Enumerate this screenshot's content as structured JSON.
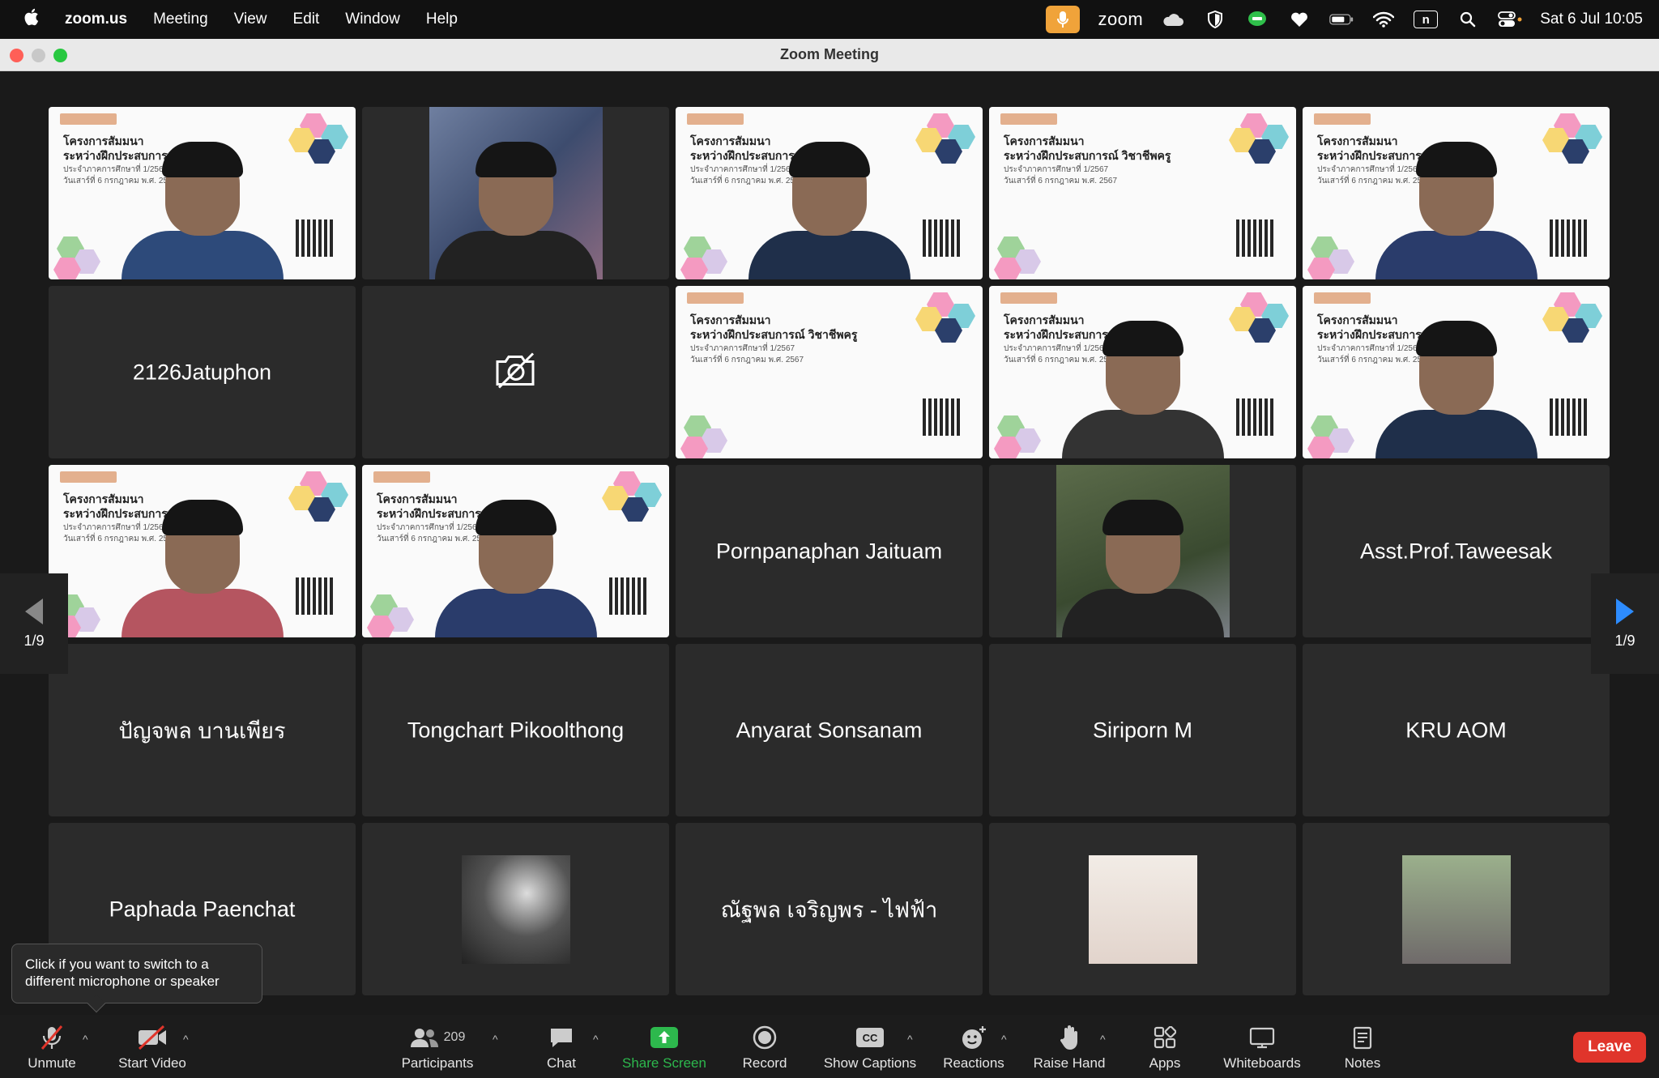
{
  "menubar": {
    "app_name": "zoom.us",
    "menus": [
      "Meeting",
      "View",
      "Edit",
      "Window",
      "Help"
    ],
    "zoom_label": "zoom",
    "clock": "Sat 6 Jul  10:05",
    "n_label": "n"
  },
  "window": {
    "title": "Zoom Meeting"
  },
  "slide": {
    "line1": "โครงการสัมมนา",
    "line2": "ระหว่างฝึกประสบการณ์ วิชาชีพครู",
    "line3": "ประจำภาคการศึกษาที่ 1/2567",
    "line4": "วันเสาร์ที่ 6 กรกฎาคม พ.ศ. 2567"
  },
  "participants": [
    {
      "kind": "slide-video"
    },
    {
      "kind": "photo-video"
    },
    {
      "kind": "slide-video"
    },
    {
      "kind": "slide-video"
    },
    {
      "kind": "slide-video"
    },
    {
      "kind": "name",
      "name": "2126Jatuphon"
    },
    {
      "kind": "camera-off",
      "icon": "video-off-icon"
    },
    {
      "kind": "slide-video"
    },
    {
      "kind": "slide-video"
    },
    {
      "kind": "slide-video"
    },
    {
      "kind": "slide-video",
      "active": true
    },
    {
      "kind": "slide-video"
    },
    {
      "kind": "name",
      "name": "Pornpanaphan Jaituam"
    },
    {
      "kind": "photo-video"
    },
    {
      "kind": "name",
      "name": "Asst.Prof.Taweesak"
    },
    {
      "kind": "name",
      "name": "ปัญจพล บานเพียร"
    },
    {
      "kind": "name",
      "name": "Tongchart Pikoolthong"
    },
    {
      "kind": "name",
      "name": "Anyarat Sonsanam"
    },
    {
      "kind": "name",
      "name": "Siriporn M"
    },
    {
      "kind": "name",
      "name": "KRU AOM"
    },
    {
      "kind": "name",
      "name": "Paphada Paenchat"
    },
    {
      "kind": "thumb"
    },
    {
      "kind": "name",
      "name": "ณัฐพล เจริญพร - ไฟฟ้า"
    },
    {
      "kind": "thumb"
    },
    {
      "kind": "thumb"
    }
  ],
  "pager": {
    "left_label": "1/9",
    "right_label": "1/9"
  },
  "tooltip": {
    "text": "Click if you want to switch to a different microphone or speaker"
  },
  "toolbar": {
    "unmute": "Unmute",
    "start_video": "Start Video",
    "participants": "Participants",
    "participant_count": "209",
    "chat": "Chat",
    "share_screen": "Share Screen",
    "record": "Record",
    "show_captions": "Show Captions",
    "cc_badge": "CC",
    "reactions": "Reactions",
    "raise_hand": "Raise Hand",
    "apps": "Apps",
    "whiteboards": "Whiteboards",
    "notes": "Notes",
    "leave": "Leave"
  },
  "colors": {
    "active_speaker": "#27c93f",
    "leave": "#e0352b",
    "share": "#2db84d",
    "mic_indicator": "#f0a33a"
  }
}
